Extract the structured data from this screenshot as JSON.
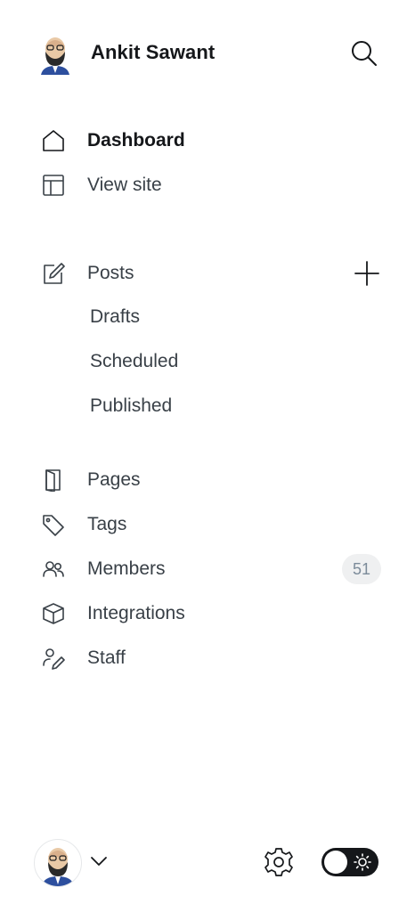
{
  "header": {
    "user_name": "Ankit Sawant",
    "avatar_icon": "user-avatar",
    "search_icon": "search-icon"
  },
  "nav": {
    "dashboard": "Dashboard",
    "view_site": "View site",
    "posts": "Posts",
    "posts_sub": [
      "Drafts",
      "Scheduled",
      "Published"
    ],
    "pages": "Pages",
    "tags": "Tags",
    "members": "Members",
    "members_count": "51",
    "integrations": "Integrations",
    "staff": "Staff"
  },
  "footer": {
    "settings_icon": "gear-icon",
    "theme_toggle": "dark-mode-toggle"
  },
  "colors": {
    "text_primary": "#15171a",
    "text_secondary": "#394047",
    "badge_bg": "#eff0f1",
    "badge_text": "#7c8b9a",
    "toggle_bg": "#15171a"
  }
}
